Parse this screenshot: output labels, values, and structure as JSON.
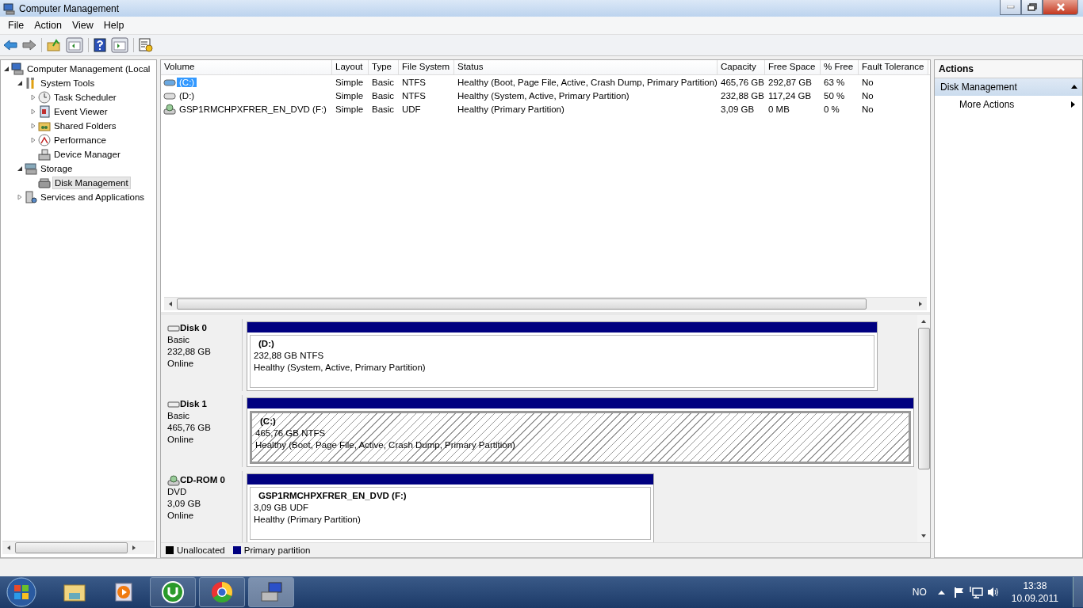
{
  "window": {
    "title": "Computer Management"
  },
  "menu": [
    "File",
    "Action",
    "View",
    "Help"
  ],
  "tree": [
    {
      "label": "Computer Management (Local",
      "expanded": true,
      "selected": false,
      "children": [
        {
          "label": "System Tools",
          "expanded": true,
          "selected": false,
          "children": [
            {
              "label": "Task Scheduler",
              "expanded": false,
              "selected": false,
              "has_children": true
            },
            {
              "label": "Event Viewer",
              "expanded": false,
              "selected": false,
              "has_children": true
            },
            {
              "label": "Shared Folders",
              "expanded": false,
              "selected": false,
              "has_children": true
            },
            {
              "label": "Performance",
              "expanded": false,
              "selected": false,
              "has_children": true
            },
            {
              "label": "Device Manager",
              "selected": false,
              "has_children": false
            }
          ]
        },
        {
          "label": "Storage",
          "expanded": true,
          "selected": false,
          "children": [
            {
              "label": "Disk Management",
              "selected": true,
              "has_children": false
            }
          ]
        },
        {
          "label": "Services and Applications",
          "expanded": false,
          "selected": false,
          "has_children": true
        }
      ]
    }
  ],
  "table": {
    "columns": [
      "Volume",
      "Layout",
      "Type",
      "File System",
      "Status",
      "Capacity",
      "Free Space",
      "% Free",
      "Fault Tolerance"
    ],
    "rows": [
      {
        "kind": "disk",
        "selected": true,
        "cells": [
          "(C:)",
          "Simple",
          "Basic",
          "NTFS",
          "Healthy (Boot, Page File, Active, Crash Dump, Primary Partition)",
          "465,76 GB",
          "292,87 GB",
          "63 %",
          "No"
        ]
      },
      {
        "kind": "disk",
        "selected": false,
        "cells": [
          "(D:)",
          "Simple",
          "Basic",
          "NTFS",
          "Healthy (System, Active, Primary Partition)",
          "232,88 GB",
          "117,24 GB",
          "50 %",
          "No"
        ]
      },
      {
        "kind": "cdrom",
        "selected": false,
        "cells": [
          "GSP1RMCHPXFRER_EN_DVD (F:)",
          "Simple",
          "Basic",
          "UDF",
          "Healthy (Primary Partition)",
          "3,09 GB",
          "0 MB",
          "0 %",
          "No"
        ]
      }
    ]
  },
  "disks": [
    {
      "kind": "disk",
      "name": "Disk 0",
      "type": "Basic",
      "size": "232,88 GB",
      "state": "Online",
      "partition": {
        "name": "(D:)",
        "size": "232,88 GB NTFS",
        "status": "Healthy (System, Active, Primary Partition)",
        "selected": false
      }
    },
    {
      "kind": "disk",
      "name": "Disk 1",
      "type": "Basic",
      "size": "465,76 GB",
      "state": "Online",
      "partition": {
        "name": "(C:)",
        "size": "465,76 GB NTFS",
        "status": "Healthy (Boot, Page File, Active, Crash Dump, Primary Partition)",
        "selected": true
      }
    },
    {
      "kind": "cdrom",
      "name": "CD-ROM 0",
      "type": "DVD",
      "size": "3,09 GB",
      "state": "Online",
      "partition": {
        "name": "GSP1RMCHPXFRER_EN_DVD  (F:)",
        "size": "3,09 GB UDF",
        "status": "Healthy (Primary Partition)",
        "selected": false
      }
    }
  ],
  "legend": [
    {
      "label": "Unallocated",
      "color": "#000000"
    },
    {
      "label": "Primary partition",
      "color": "#000080"
    }
  ],
  "actions": {
    "title": "Actions",
    "section": {
      "label": "Disk Management",
      "expanded": true
    },
    "items": [
      "More Actions"
    ]
  },
  "taskbar": {
    "language": "NO",
    "time": "13:38",
    "date": "10.09.2011"
  }
}
